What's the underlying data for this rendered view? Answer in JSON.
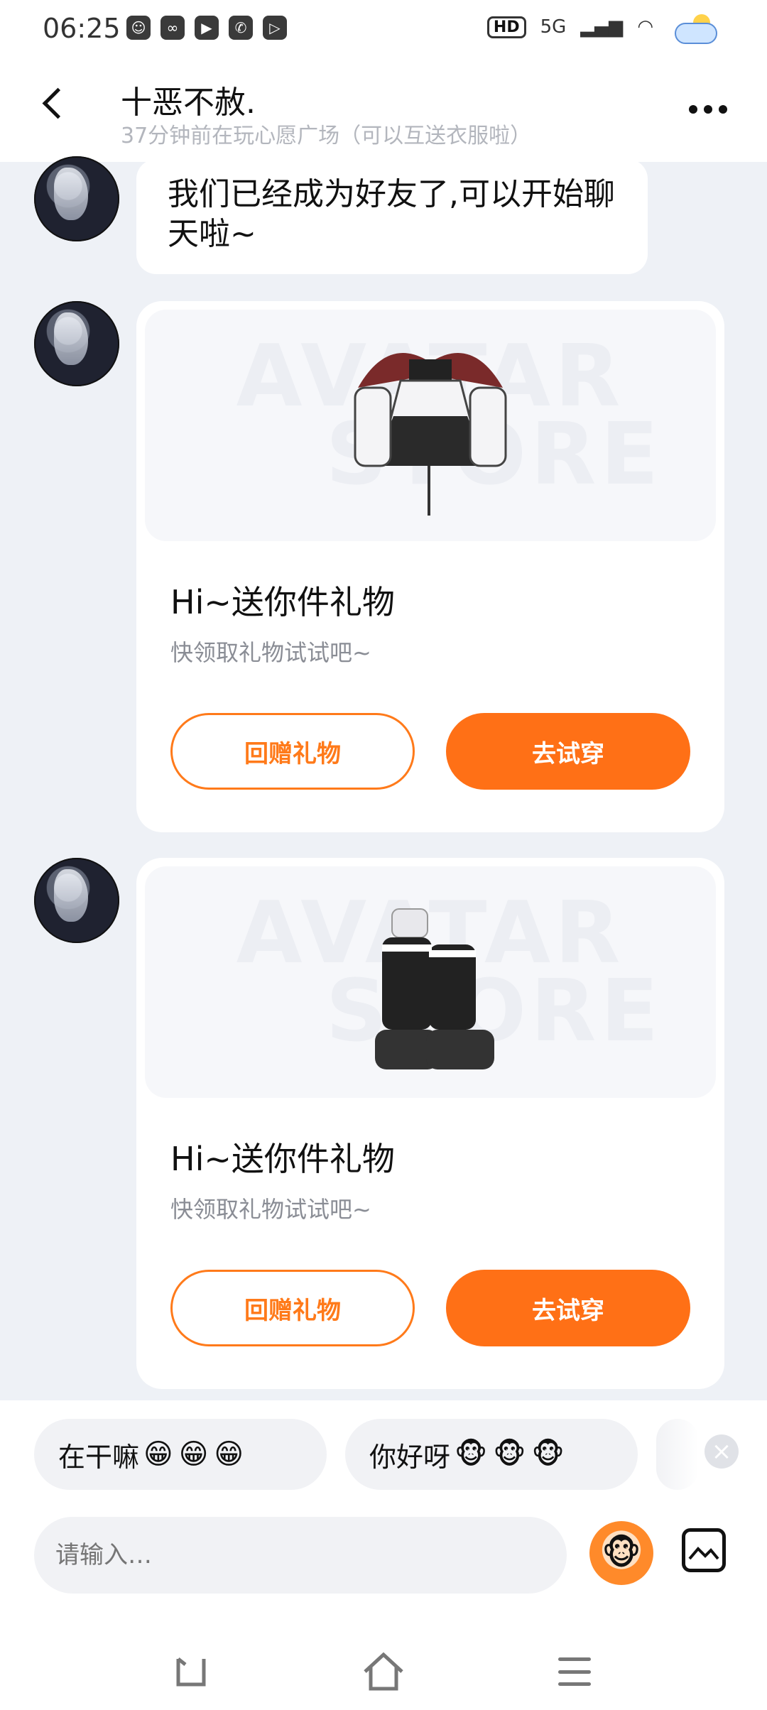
{
  "status_bar": {
    "time": "06:25",
    "hd_label": "HD",
    "network_label": "5G"
  },
  "header": {
    "title": "十恶不赦.",
    "subtitle": "37分钟前在玩心愿广场（可以互送衣服啦）"
  },
  "messages": {
    "text_bubble": "我们已经成为好友了,可以开始聊天啦~",
    "gift_cards": [
      {
        "watermark_line1": "AVATAR",
        "watermark_line2": "STORE",
        "title": "Hi~送你件礼物",
        "desc": "快领取礼物试试吧~",
        "return_gift": "回赠礼物",
        "try_on": "去试穿"
      },
      {
        "watermark_line1": "AVATAR",
        "watermark_line2": "STORE",
        "title": "Hi~送你件礼物",
        "desc": "快领取礼物试试吧~",
        "return_gift": "回赠礼物",
        "try_on": "去试穿"
      }
    ]
  },
  "quick_replies": [
    {
      "text": "在干嘛",
      "emojis": "😁😁😁"
    },
    {
      "text": "你好呀",
      "emojis": "🐵🐵🐵"
    }
  ],
  "input": {
    "placeholder": "请输入…"
  },
  "colors": {
    "accent": "#ff7016",
    "background": "#eef1f6"
  }
}
